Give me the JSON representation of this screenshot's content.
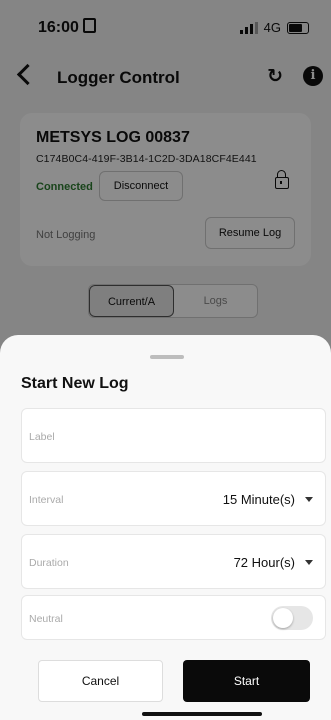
{
  "status_bar": {
    "time": "16:00",
    "network": "4G"
  },
  "nav": {
    "title": "Logger Control"
  },
  "device": {
    "name": "METSYS LOG 00837",
    "id": "C174B0C4-419F-3B14-1C2D-3DA18CF4E441",
    "status": "Connected",
    "disconnect_label": "Disconnect",
    "logging_status": "Not Logging",
    "resume_label": "Resume Log"
  },
  "tabs": [
    {
      "label": "Current/A",
      "active": true
    },
    {
      "label": "Logs",
      "active": false
    }
  ],
  "sheet": {
    "title": "Start New Log",
    "label_field": {
      "placeholder": "Label"
    },
    "interval": {
      "label": "Interval",
      "value": "15 Minute(s)"
    },
    "duration": {
      "label": "Duration",
      "value": "72 Hour(s)"
    },
    "neutral": {
      "label": "Neutral",
      "enabled": false
    },
    "cancel_label": "Cancel",
    "start_label": "Start"
  },
  "colors": {
    "connected": "#2e7d32",
    "primary_button": "#0a0a0a"
  }
}
